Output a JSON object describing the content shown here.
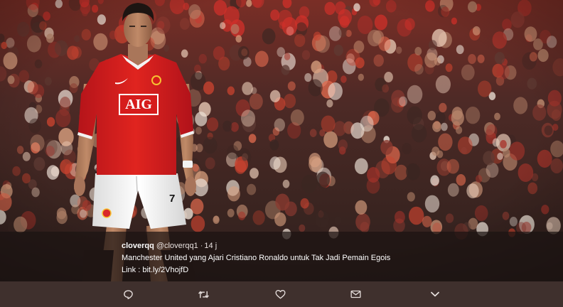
{
  "tweet": {
    "display_name": "cloverqq",
    "handle": "@cloverqq1",
    "separator": "·",
    "time": "14 j",
    "body": "Manchester United yang Ajari Cristiano Ronaldo untuk Tak Jadi Pemain Egois",
    "link_label": "Link :",
    "link_url": "bit.ly/2VhojfD"
  },
  "photo": {
    "shirt_sponsor": "AIG",
    "shirt_number": "7"
  },
  "actions": [
    {
      "name": "reply",
      "icon": "reply-icon"
    },
    {
      "name": "retweet",
      "icon": "retweet-icon"
    },
    {
      "name": "like",
      "icon": "heart-icon"
    },
    {
      "name": "direct-message",
      "icon": "envelope-icon"
    },
    {
      "name": "more",
      "icon": "chevron-down-icon"
    }
  ],
  "colors": {
    "jersey": "#d61c1c",
    "crowd_base": "#5a2a24",
    "overlay": "#1c1412",
    "action_bar": "#3f302d"
  }
}
